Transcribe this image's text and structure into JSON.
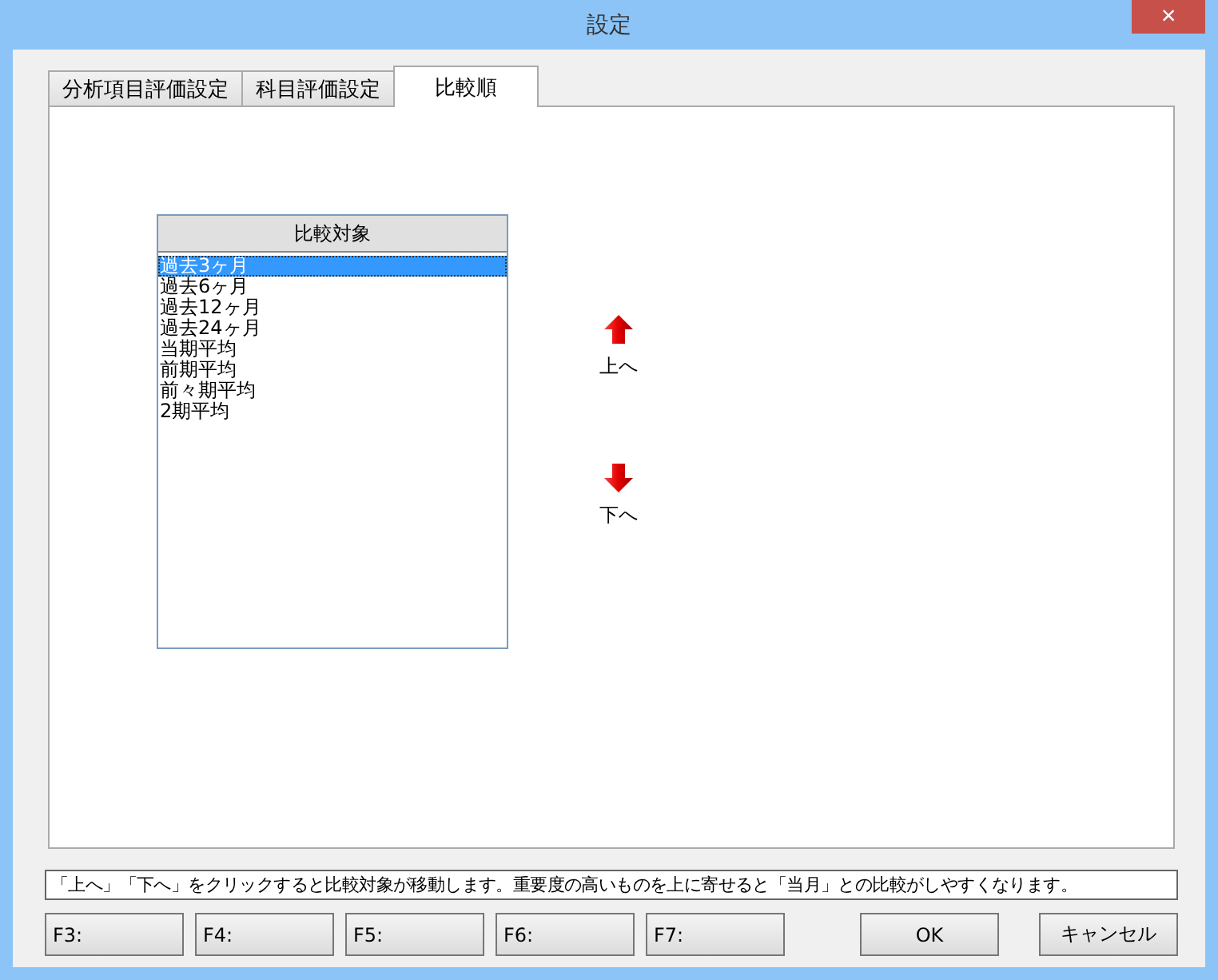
{
  "window": {
    "title": "設定",
    "close": "×"
  },
  "tabs": [
    {
      "label": "分析項目評価設定",
      "selected": false
    },
    {
      "label": "科目評価設定",
      "selected": false
    },
    {
      "label": "比較順",
      "selected": true
    }
  ],
  "list": {
    "header": "比較対象",
    "items": [
      {
        "label": "過去3ヶ月",
        "selected": true
      },
      {
        "label": "過去6ヶ月",
        "selected": false
      },
      {
        "label": "過去12ヶ月",
        "selected": false
      },
      {
        "label": "過去24ヶ月",
        "selected": false
      },
      {
        "label": "当期平均",
        "selected": false
      },
      {
        "label": "前期平均",
        "selected": false
      },
      {
        "label": "前々期平均",
        "selected": false
      },
      {
        "label": "2期平均",
        "selected": false
      }
    ]
  },
  "move_buttons": [
    {
      "kind": "up",
      "label": "上へ"
    },
    {
      "kind": "down",
      "label": "下へ"
    }
  ],
  "hint": "「上へ」「下へ」をクリックすると比較対象が移動します。重要度の高いものを上に寄せると「当月」との比較がしやすくなります。",
  "function_keys": [
    "F3:",
    "F4:",
    "F5:",
    "F6:",
    "F7:"
  ],
  "buttons": [
    "OK",
    "キャンセル"
  ]
}
